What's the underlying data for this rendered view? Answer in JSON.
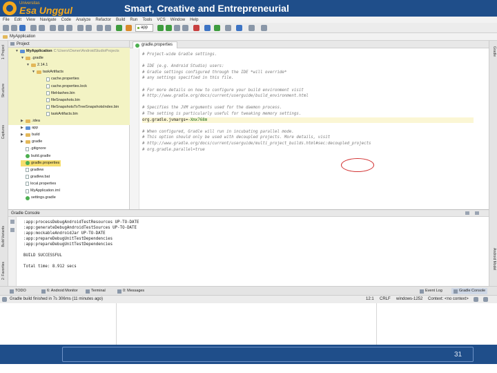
{
  "slide": {
    "university_small": "Universitas",
    "university_name": "Esa Unggul",
    "tagline": "Smart, Creative and Entrepreneurial",
    "page_number": "31"
  },
  "menu": [
    "File",
    "Edit",
    "View",
    "Navigate",
    "Code",
    "Analyze",
    "Refactor",
    "Build",
    "Run",
    "Tools",
    "VCS",
    "Window",
    "Help"
  ],
  "toolbar": {
    "run_config": "app"
  },
  "navbar": {
    "breadcrumb": "MyApplication"
  },
  "left_strip": [
    "1: Project",
    "Structure",
    "Captures",
    "Build Variants",
    "2: Favorites"
  ],
  "right_strip": [
    "Gradle",
    "Android Model"
  ],
  "project_panel": {
    "title": "Project",
    "tree": [
      {
        "label": "MyApplication",
        "extra": "C:\\Users\\Owner\\AndroidStudioProjects",
        "kind": "module",
        "arrow": "▼"
      },
      {
        "label": ".gradle",
        "kind": "folder",
        "arrow": "▼"
      },
      {
        "label": "2.14.1",
        "kind": "folder",
        "arrow": "▼"
      },
      {
        "label": "taskArtifacts",
        "kind": "folder",
        "arrow": "▼"
      },
      {
        "label": "cache.properties",
        "kind": "file",
        "arrow": ""
      },
      {
        "label": "cache.properties.lock",
        "kind": "file",
        "arrow": ""
      },
      {
        "label": "fileHashes.bin",
        "kind": "file",
        "arrow": ""
      },
      {
        "label": "fileSnapshots.bin",
        "kind": "file",
        "arrow": ""
      },
      {
        "label": "fileSnapshotsToTreeSnapshotsIndex.bin",
        "kind": "file",
        "arrow": ""
      },
      {
        "label": "taskArtifacts.bin",
        "kind": "file",
        "arrow": ""
      },
      {
        "label": ".idea",
        "kind": "folder",
        "arrow": "▶"
      },
      {
        "label": "app",
        "kind": "module",
        "arrow": "▶"
      },
      {
        "label": "build",
        "kind": "folder",
        "arrow": "▶"
      },
      {
        "label": "gradle",
        "kind": "folder",
        "arrow": "▶"
      },
      {
        "label": ".gitignore",
        "kind": "file",
        "arrow": ""
      },
      {
        "label": "build.gradle",
        "kind": "gradle",
        "arrow": ""
      },
      {
        "label": "gradle.properties",
        "kind": "gradle",
        "arrow": "",
        "selected": true
      },
      {
        "label": "gradlew",
        "kind": "file",
        "arrow": ""
      },
      {
        "label": "gradlew.bat",
        "kind": "file",
        "arrow": ""
      },
      {
        "label": "local.properties",
        "kind": "file",
        "arrow": ""
      },
      {
        "label": "MyApplication.iml",
        "kind": "file",
        "arrow": ""
      },
      {
        "label": "settings.gradle",
        "kind": "gradle",
        "arrow": ""
      }
    ]
  },
  "editor": {
    "tab": "gradle.properties",
    "lines": [
      "# Project-wide Gradle settings.",
      "",
      "# IDE (e.g. Android Studio) users:",
      "# Gradle settings configured through the IDE *will override*",
      "# any settings specified in this file.",
      "",
      "# For more details on how to configure your build environment visit",
      "# http://www.gradle.org/docs/current/userguide/build_environment.html",
      "",
      "# Specifies the JVM arguments used for the daemon process.",
      "# The setting is particularly useful for tweaking memory settings.",
      "org.gradle.jvmargs=",
      "",
      "# When configured, Gradle will run in incubating parallel mode.",
      "# This option should only be used with decoupled projects. More details, visit",
      "# http://www.gradle.org/docs/current/userguide/multi_project_builds.html#sec:decoupled_projects",
      "# org.gradle.parallel=true"
    ],
    "jvmargs_value": "-Xmx768m"
  },
  "console": {
    "title": "Gradle Console",
    "lines": [
      ":app:processDebugAndroidTestResources UP-TO-DATE",
      ":app:generateDebugAndroidTestSources UP-TO-DATE",
      ":app:mockableAndroidJar UP-TO-DATE",
      ":app:prepareDebugUnitTestDependencies",
      ":app:prepareDebugUnitTestDependencies",
      "",
      "BUILD SUCCESSFUL",
      "",
      "Total time: 8.912 secs"
    ]
  },
  "bottom_tabs": {
    "todo": "TODO",
    "android_monitor": "6: Android Monitor",
    "terminal": "Terminal",
    "messages": "0: Messages",
    "event_log": "Event Log",
    "gradle_console": "Gradle Console"
  },
  "status": {
    "message": "Gradle build finished in 7s 306ms (11 minutes ago)",
    "position": "12:1",
    "line_sep": "CRLF",
    "encoding": "windows-1252",
    "context": "Context: <no context>"
  }
}
